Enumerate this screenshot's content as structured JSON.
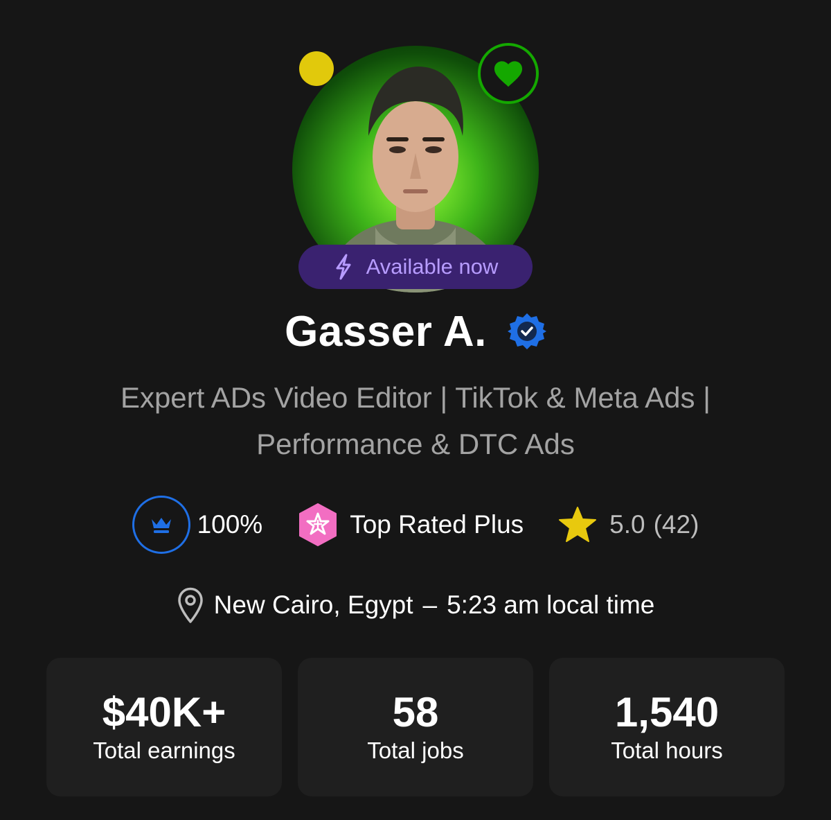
{
  "profile": {
    "name": "Gasser A.",
    "availability_label": "Available now",
    "title": "Expert ADs Video Editor | TikTok & Meta Ads | Performance & DTC Ads",
    "job_success": "100%",
    "badge_label": "Top Rated Plus",
    "rating": "5.0",
    "rating_count": "(42)",
    "location": "New Cairo, Egypt",
    "local_time": "5:23 am local time",
    "separator": "–"
  },
  "stats": [
    {
      "value": "$40K+",
      "label": "Total earnings"
    },
    {
      "value": "58",
      "label": "Total jobs"
    },
    {
      "value": "1,540",
      "label": "Total hours"
    }
  ],
  "colors": {
    "background": "#161616",
    "card": "#1f1f1f",
    "available_pill": "#3a2270",
    "available_text": "#b79cff",
    "verified_blue": "#1f6fe5",
    "favorite_green": "#14a800",
    "presence_yellow": "#e1c90c",
    "top_rated_pink": "#f26ec2",
    "star_yellow": "#e8c90e"
  },
  "icons": [
    "presence-dot",
    "heart-icon",
    "lightning-icon",
    "verified-badge-icon",
    "crown-icon",
    "top-rated-plus-icon",
    "star-icon",
    "location-pin-icon"
  ]
}
